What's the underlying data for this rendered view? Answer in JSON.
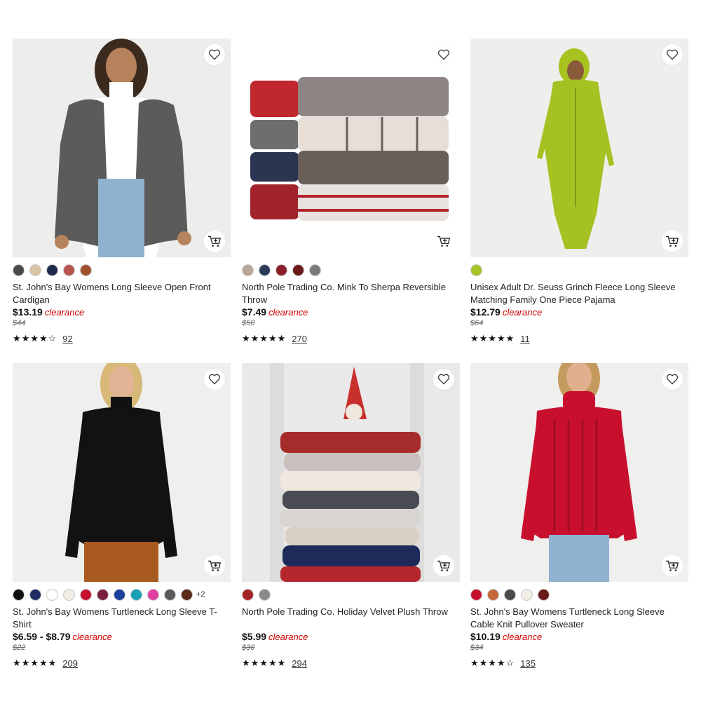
{
  "products": [
    {
      "title": "St. John's Bay Womens Long Sleeve Open Front Cardigan",
      "price": "$13.19",
      "badge": "clearance",
      "original_price": "$44",
      "stars": "★★★★☆",
      "reviews": "92",
      "image": "woman-grey-cardigan",
      "swatches": [
        "#4a4a4a",
        "#d9c2a4",
        "#1d2a4e",
        "#b85450",
        "#a0522d"
      ]
    },
    {
      "title": "North Pole Trading Co. Mink To Sherpa Reversible Throw",
      "price": "$7.49",
      "badge": "clearance",
      "original_price": "$50",
      "stars": "★★★★★",
      "reviews": "270",
      "image": "stacked-throws",
      "swatches": [
        "#b9a89a",
        "#2c3a5a",
        "#8b1e2b",
        "#6b1a1a",
        "#7a7a7a"
      ]
    },
    {
      "title": "Unisex Adult Dr. Seuss Grinch Fleece Long Sleeve Matching Family One Piece Pajama",
      "price": "$12.79",
      "badge": "clearance",
      "original_price": "$64",
      "stars": "★★★★★",
      "reviews": "11",
      "image": "grinch-onesie",
      "swatches": [
        "#a6c526"
      ]
    },
    {
      "title": "St. John's Bay Womens Turtleneck Long Sleeve T-Shirt",
      "price": "$6.59 - $8.79",
      "badge": "clearance",
      "original_price": "$22",
      "stars": "★★★★★",
      "reviews": "209",
      "image": "woman-black-turtleneck",
      "swatches": [
        "#111111",
        "#1f2d66",
        "#ffffff",
        "#f1ede4",
        "#c8102e",
        "#7a1f3d",
        "#1b3f9a",
        "#1aa0b5",
        "#e23fa3",
        "#5a5a5a",
        "#5a2a1a"
      ],
      "more": "+2"
    },
    {
      "title": "North Pole Trading Co. Holiday Velvet Plush Throw",
      "price": "$5.99",
      "badge": "clearance",
      "original_price": "$30",
      "stars": "★★★★★",
      "reviews": "294",
      "image": "holiday-throws-stack",
      "swatches": [
        "#a32424",
        "#8a8a8a"
      ]
    },
    {
      "title": "St. John's Bay Womens Turtleneck Long Sleeve Cable Knit Pullover Sweater",
      "price": "$10.19",
      "badge": "clearance",
      "original_price": "$34",
      "stars": "★★★★☆",
      "reviews": "135",
      "image": "woman-red-sweater",
      "swatches": [
        "#c8102e",
        "#c4683a",
        "#4a4a4a",
        "#f1ede4",
        "#6b1a1a"
      ]
    }
  ],
  "icons": {
    "favorite": "heart-outline-icon",
    "add_to_cart": "cart-plus-icon"
  }
}
